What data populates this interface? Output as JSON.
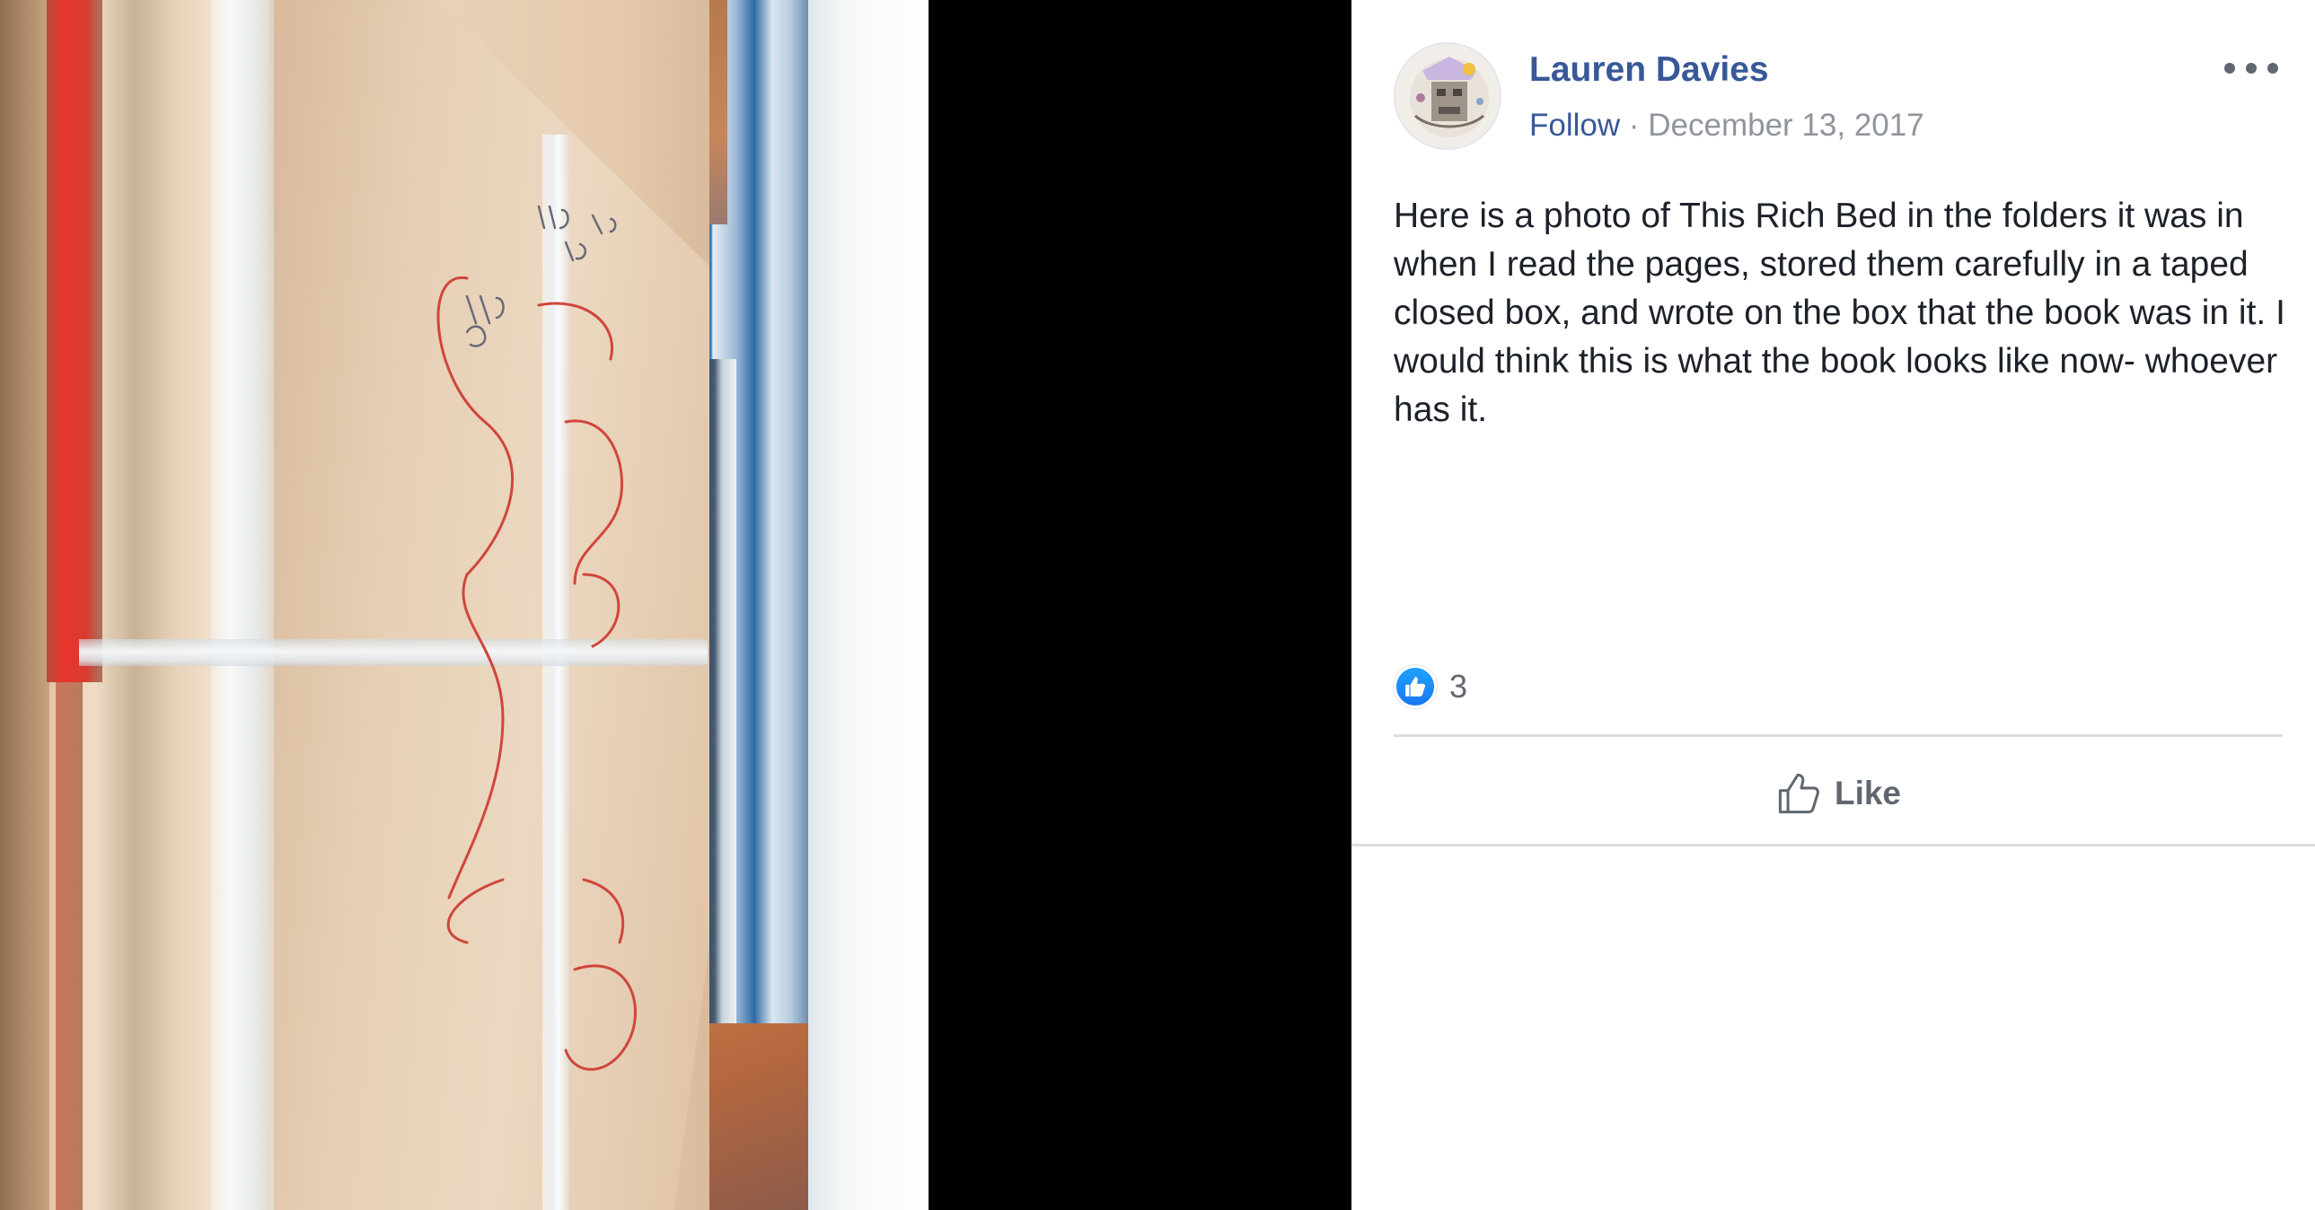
{
  "post": {
    "author": "Lauren Davies",
    "follow_label": "Follow",
    "separator": "·",
    "date": "December 13, 2017",
    "text": "Here is a photo of This Rich Bed in the folders it was in when I read the pages, stored them carefully in a taped closed box, and wrote on the box that the book was in it. I would think this is what the book looks like now- whoever has it.",
    "reaction_count": "3",
    "like_label": "Like"
  },
  "icons": {
    "more": "more-options-icon",
    "reaction": "like-reaction-icon",
    "like": "thumbs-up-outline-icon"
  },
  "colors": {
    "link": "#385898",
    "meta_gray": "#90949c",
    "text": "#1d2129",
    "reaction_blue": "#1877f2",
    "viewer_bg": "#000000"
  }
}
